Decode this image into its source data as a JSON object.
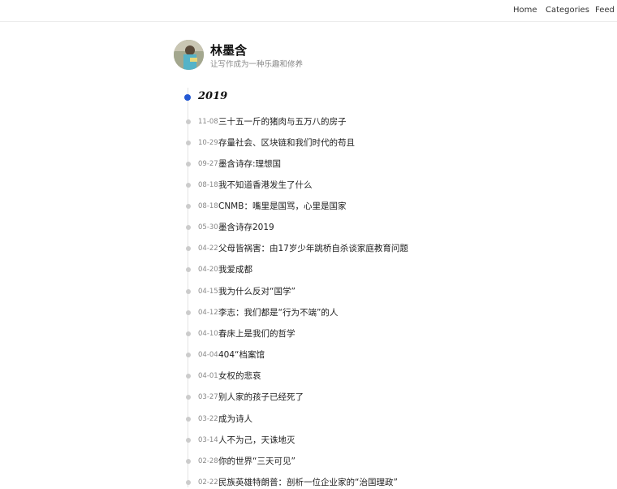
{
  "nav": {
    "items": [
      "Home",
      "Categories",
      "Feed"
    ]
  },
  "profile": {
    "name": "林墨含",
    "tagline": "让写作成为一种乐趣和修养"
  },
  "archive": {
    "year": "2019",
    "posts": [
      {
        "date": "11-08",
        "title": "三十五一斤的猪肉与五万八的房子"
      },
      {
        "date": "10-29",
        "title": "存量社会、区块链和我们时代的苟且"
      },
      {
        "date": "09-27",
        "title": "墨含诗存:理想国"
      },
      {
        "date": "08-18",
        "title": "我不知道香港发生了什么"
      },
      {
        "date": "08-18",
        "title": "CNMB：嘴里是国骂，心里是国家"
      },
      {
        "date": "05-30",
        "title": "墨含诗存2019"
      },
      {
        "date": "04-22",
        "title": "父母皆祸害：由17岁少年跳桥自杀谈家庭教育问题"
      },
      {
        "date": "04-20",
        "title": "我爱成都"
      },
      {
        "date": "04-15",
        "title": "我为什么反对“国学”"
      },
      {
        "date": "04-12",
        "title": "李志：我们都是“行为不端”的人"
      },
      {
        "date": "04-10",
        "title": "春床上是我们的哲学"
      },
      {
        "date": "04-04",
        "title": "404“档案馆"
      },
      {
        "date": "04-01",
        "title": "女权的悲哀"
      },
      {
        "date": "03-27",
        "title": "别人家的孩子已经死了"
      },
      {
        "date": "03-22",
        "title": "成为诗人"
      },
      {
        "date": "03-14",
        "title": "人不为己，天诛地灭"
      },
      {
        "date": "02-28",
        "title": "你的世界“三天可见”"
      },
      {
        "date": "02-22",
        "title": "民族英雄特朗普：剖析一位企业家的“治国理政”"
      }
    ]
  }
}
